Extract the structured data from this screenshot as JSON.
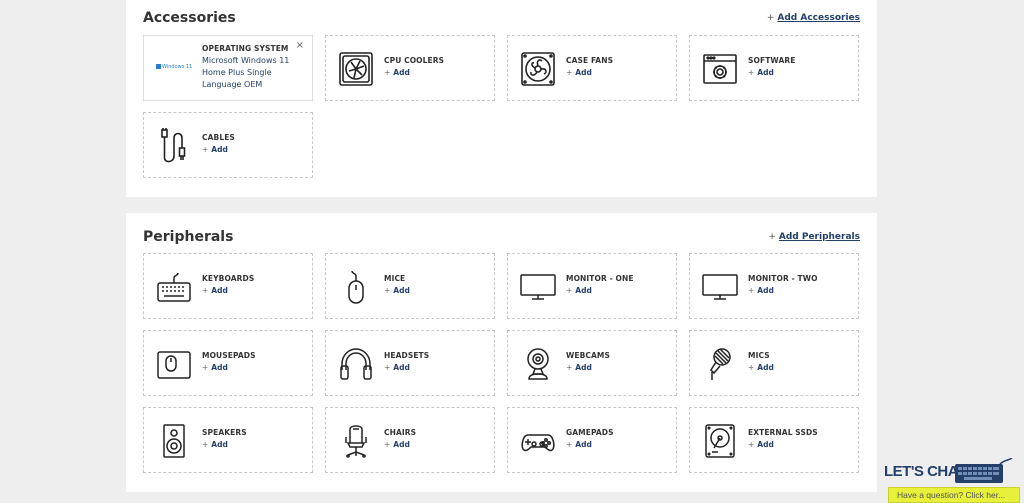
{
  "accessories": {
    "title": "Accessories",
    "add_plus": "+",
    "add_label": "Add Accessories",
    "selected": {
      "category": "OPERATING SYSTEM",
      "value": "Microsoft Windows 11 Home Plus Single Language OEM",
      "logo_text": "Windows 11",
      "remove": "×"
    },
    "items": [
      {
        "name": "CPU COOLERS",
        "add": "Add",
        "icon": "cpu-cooler-icon"
      },
      {
        "name": "CASE FANS",
        "add": "Add",
        "icon": "case-fan-icon"
      },
      {
        "name": "SOFTWARE",
        "add": "Add",
        "icon": "software-icon"
      },
      {
        "name": "CABLES",
        "add": "Add",
        "icon": "cable-icon"
      }
    ]
  },
  "peripherals": {
    "title": "Peripherals",
    "add_plus": "+",
    "add_label": "Add Peripherals",
    "items": [
      {
        "name": "KEYBOARDS",
        "add": "Add",
        "icon": "keyboard-icon"
      },
      {
        "name": "MICE",
        "add": "Add",
        "icon": "mouse-icon"
      },
      {
        "name": "MONITOR - ONE",
        "add": "Add",
        "icon": "monitor-icon"
      },
      {
        "name": "MONITOR - TWO",
        "add": "Add",
        "icon": "monitor-icon"
      },
      {
        "name": "MOUSEPADS",
        "add": "Add",
        "icon": "mousepad-icon"
      },
      {
        "name": "HEADSETS",
        "add": "Add",
        "icon": "headset-icon"
      },
      {
        "name": "WEBCAMS",
        "add": "Add",
        "icon": "webcam-icon"
      },
      {
        "name": "MICS",
        "add": "Add",
        "icon": "microphone-icon"
      },
      {
        "name": "SPEAKERS",
        "add": "Add",
        "icon": "speaker-icon"
      },
      {
        "name": "CHAIRS",
        "add": "Add",
        "icon": "chair-icon"
      },
      {
        "name": "GAMEPADS",
        "add": "Add",
        "icon": "gamepad-icon"
      },
      {
        "name": "EXTERNAL SSDS",
        "add": "Add",
        "icon": "hard-drive-icon"
      }
    ]
  },
  "chat": {
    "title": "LET'S CHAT",
    "prompt": "Have a question? Click her..."
  },
  "colors": {
    "accent": "#24406a",
    "chat_bar": "#e7f03a"
  }
}
